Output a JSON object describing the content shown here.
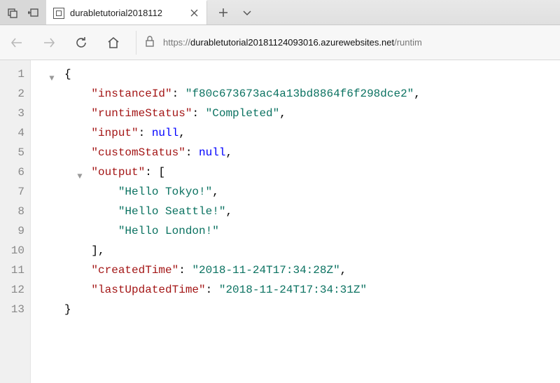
{
  "titlebar": {
    "tab_title": "durabletutorial2018112"
  },
  "addr": {
    "proto": "https://",
    "host": "durabletutorial20181124093016.azurewebsites.net",
    "rest": "/runtim"
  },
  "json": {
    "instanceId_key": "\"instanceId\"",
    "instanceId_val": "\"f80c673673ac4a13bd8864f6f298dce2\"",
    "runtimeStatus_key": "\"runtimeStatus\"",
    "runtimeStatus_val": "\"Completed\"",
    "input_key": "\"input\"",
    "input_val": "null",
    "customStatus_key": "\"customStatus\"",
    "customStatus_val": "null",
    "output_key": "\"output\"",
    "output_0": "\"Hello Tokyo!\"",
    "output_1": "\"Hello Seattle!\"",
    "output_2": "\"Hello London!\"",
    "createdTime_key": "\"createdTime\"",
    "createdTime_val": "\"2018-11-24T17:34:28Z\"",
    "lastUpdatedTime_key": "\"lastUpdatedTime\"",
    "lastUpdatedTime_val": "\"2018-11-24T17:34:31Z\""
  },
  "lines": [
    "1",
    "2",
    "3",
    "4",
    "5",
    "6",
    "7",
    "8",
    "9",
    "10",
    "11",
    "12",
    "13"
  ]
}
